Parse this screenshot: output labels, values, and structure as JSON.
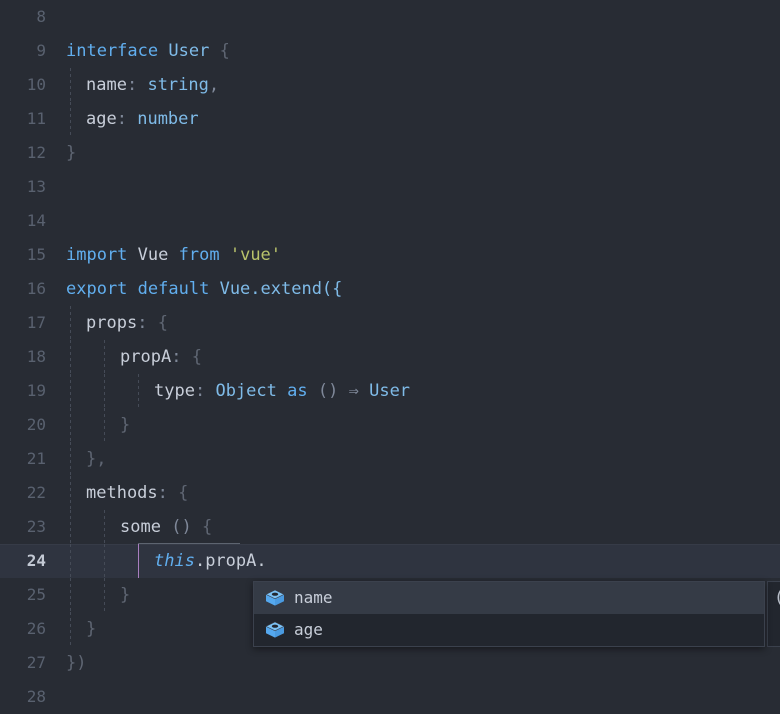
{
  "editor": {
    "background_color": "#282c34",
    "current_line": 24,
    "line_start": 8,
    "line_end": 28,
    "gutter_color": "#59616f",
    "current_line_bg": "#2f3440"
  },
  "lines": [
    {
      "number": "8",
      "text": ""
    },
    {
      "number": "9",
      "text": "interface User {"
    },
    {
      "number": "10",
      "text": "  name: string,"
    },
    {
      "number": "11",
      "text": "  age: number"
    },
    {
      "number": "12",
      "text": "}"
    },
    {
      "number": "13",
      "text": ""
    },
    {
      "number": "14",
      "text": ""
    },
    {
      "number": "15",
      "text": "import Vue from 'vue'"
    },
    {
      "number": "16",
      "text": "export default Vue.extend({"
    },
    {
      "number": "17",
      "text": "  props: {"
    },
    {
      "number": "18",
      "text": "    propA: {"
    },
    {
      "number": "19",
      "text": "      type: Object as () => User"
    },
    {
      "number": "20",
      "text": "    }"
    },
    {
      "number": "21",
      "text": "  },"
    },
    {
      "number": "22",
      "text": "  methods: {"
    },
    {
      "number": "23",
      "text": "    some () {"
    },
    {
      "number": "24",
      "text": "      this.propA."
    },
    {
      "number": "25",
      "text": "    }"
    },
    {
      "number": "26",
      "text": "  }"
    },
    {
      "number": "27",
      "text": "})"
    },
    {
      "number": "28",
      "text": ""
    }
  ],
  "tokens": {
    "interface": "interface",
    "user": "User",
    "open_brace": "{",
    "close_brace": "}",
    "name_key": "name",
    "colon": ":",
    "string_type": "string",
    "comma": ",",
    "age_key": "age",
    "number_type": "number",
    "import": "import",
    "vue_ident": "Vue",
    "from": "from",
    "vue_string": "'vue'",
    "export": "export",
    "default": "default",
    "vue_extend": "Vue.extend({",
    "props": "props",
    "propA": "propA",
    "type_key": "type",
    "object": "Object",
    "as": "as",
    "parens": "()",
    "arrow": "⇒",
    "methods": "methods",
    "some": "some",
    "this": "this",
    "dot_propA": ".propA.",
    "close_paren_brace": "})",
    "comma_brace": "},"
  },
  "autocomplete": {
    "visible": true,
    "items": [
      {
        "label": "name",
        "icon": "property-cube-icon",
        "selected": true
      },
      {
        "label": "age",
        "icon": "property-cube-icon",
        "selected": false
      }
    ],
    "selected_bg": "#353b46",
    "item_bg": "#22262e",
    "border_color": "#3b414d",
    "icon_color": "#61afef"
  },
  "doc_panel": {
    "visible": true,
    "text": "("
  },
  "colors": {
    "keyword": "#61aeee",
    "type": "#7fbbe8",
    "identifier": "#c8ced9",
    "punctuation": "#7f8899",
    "string": "#b9c36b",
    "error_squiggle": "#e05252",
    "active_indent_guide": "#a97ec0",
    "indent_guide": "#454b57"
  }
}
